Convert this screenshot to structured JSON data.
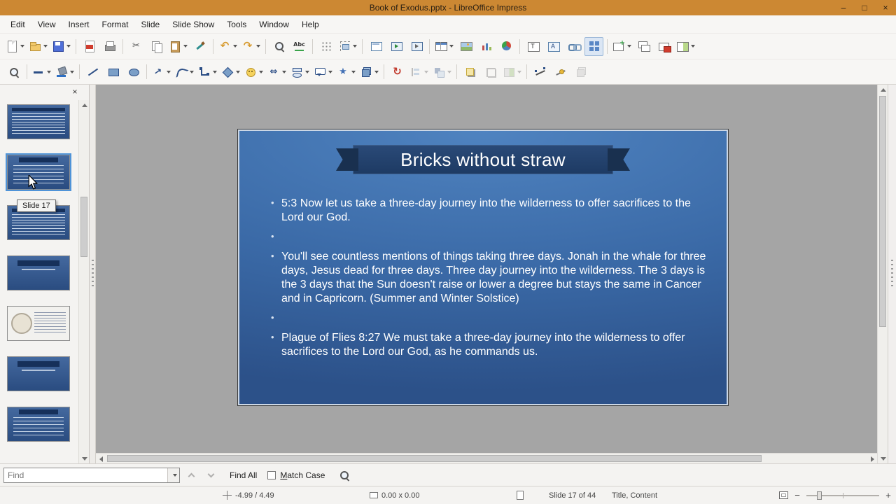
{
  "window": {
    "title": "Book of Exodus.pptx - LibreOffice Impress",
    "minimize_label": "–",
    "maximize_label": "□",
    "close_label": "×"
  },
  "menubar": {
    "items": [
      "Edit",
      "View",
      "Insert",
      "Format",
      "Slide",
      "Slide Show",
      "Tools",
      "Window",
      "Help"
    ]
  },
  "toolbar_main": {
    "items": [
      {
        "name": "new-document",
        "dropdown": true
      },
      {
        "name": "open",
        "dropdown": true
      },
      {
        "name": "save",
        "dropdown": true
      },
      {
        "sep": true
      },
      {
        "name": "export-pdf"
      },
      {
        "name": "print"
      },
      {
        "sep": true
      },
      {
        "name": "cut"
      },
      {
        "name": "copy"
      },
      {
        "name": "paste",
        "dropdown": true
      },
      {
        "name": "clone-formatting"
      },
      {
        "sep": true
      },
      {
        "name": "undo",
        "dropdown": true
      },
      {
        "name": "redo",
        "dropdown": true
      },
      {
        "sep": true
      },
      {
        "name": "find-replace"
      },
      {
        "name": "spelling"
      },
      {
        "sep": true
      },
      {
        "name": "display-grid"
      },
      {
        "name": "snap-guides",
        "dropdown": true
      },
      {
        "sep": true
      },
      {
        "name": "master-slide"
      },
      {
        "name": "start-first-slide"
      },
      {
        "name": "start-current-slide"
      },
      {
        "sep": true
      },
      {
        "name": "insert-table",
        "dropdown": true
      },
      {
        "name": "insert-image"
      },
      {
        "name": "insert-chart"
      },
      {
        "name": "insert-audio-video"
      },
      {
        "sep": true
      },
      {
        "name": "insert-text-box"
      },
      {
        "name": "insert-fontwork"
      },
      {
        "name": "insert-hyperlink"
      },
      {
        "name": "display-views",
        "active": true
      },
      {
        "sep": true
      },
      {
        "name": "new-slide",
        "dropdown": true
      },
      {
        "name": "duplicate-slide"
      },
      {
        "name": "delete-slide"
      },
      {
        "name": "slide-layout",
        "dropdown": true
      }
    ]
  },
  "toolbar_drawing": {
    "items": [
      {
        "name": "zoom"
      },
      {
        "sep": true
      },
      {
        "name": "line-style",
        "dropdown": true
      },
      {
        "name": "fill-color",
        "dropdown": true
      },
      {
        "sep": true
      },
      {
        "name": "insert-line"
      },
      {
        "name": "rectangle"
      },
      {
        "name": "ellipse"
      },
      {
        "sep": true
      },
      {
        "name": "lines-arrows",
        "dropdown": true
      },
      {
        "name": "curves-polygons",
        "dropdown": true
      },
      {
        "name": "connectors",
        "dropdown": true
      },
      {
        "name": "basic-shapes",
        "dropdown": true
      },
      {
        "name": "symbol-shapes",
        "dropdown": true
      },
      {
        "name": "block-arrows",
        "dropdown": true
      },
      {
        "name": "flowchart",
        "dropdown": true
      },
      {
        "name": "callout-shapes",
        "dropdown": true
      },
      {
        "name": "star-shapes",
        "dropdown": true
      },
      {
        "name": "3d-objects",
        "dropdown": true
      },
      {
        "sep": true
      },
      {
        "name": "rotate"
      },
      {
        "name": "align-objects",
        "dropdown": true,
        "disabled": true
      },
      {
        "name": "arrange",
        "dropdown": true,
        "disabled": true
      },
      {
        "sep": true
      },
      {
        "name": "shadow"
      },
      {
        "name": "crop",
        "disabled": true
      },
      {
        "name": "image-filter",
        "dropdown": true,
        "disabled": true
      },
      {
        "sep": true
      },
      {
        "name": "edit-points"
      },
      {
        "name": "glue-points"
      },
      {
        "name": "toggle-extrusion",
        "disabled": true
      }
    ]
  },
  "slide_panel": {
    "close_label": "×",
    "tooltip": "Slide 17",
    "thumbnails": [
      {
        "kind": "text"
      },
      {
        "kind": "content",
        "selected": true
      },
      {
        "kind": "text"
      },
      {
        "kind": "title"
      },
      {
        "kind": "image"
      },
      {
        "kind": "title"
      },
      {
        "kind": "content"
      }
    ]
  },
  "slide": {
    "title": "Bricks without straw",
    "bullets": [
      "5:3 Now let us take a three-day journey into the wilderness to offer sacrifices to the Lord our God.",
      "",
      "You'll see countless mentions of things taking three days. Jonah in the whale for three days, Jesus dead for three days. Three day journey into the wilderness. The 3 days is the 3 days that the Sun doesn't raise or lower a degree but stays the same in Cancer and in Capricorn. (Summer and Winter Solstice)",
      "",
      "Plague of Flies 8:27 We must take a three-day journey into the wilderness to offer sacrifices to the Lord our God, as he commands us."
    ]
  },
  "find_toolbar": {
    "placeholder": "Find",
    "find_all_label": "Find All",
    "match_case_label": "Match Case"
  },
  "statusbar": {
    "cursor_position": "-4.99 / 4.49",
    "object_size": "0.00 x 0.00",
    "slide_info": "Slide 17 of 44",
    "layout_name": "Title, Content",
    "zoom_out_label": "−",
    "zoom_in_label": "+"
  },
  "colors": {
    "titlebar": "#cc8833",
    "slide_top": "#4f83c0",
    "slide_bottom": "#2c5189",
    "banner": "#1d3a63",
    "selection": "#4f93d8"
  }
}
